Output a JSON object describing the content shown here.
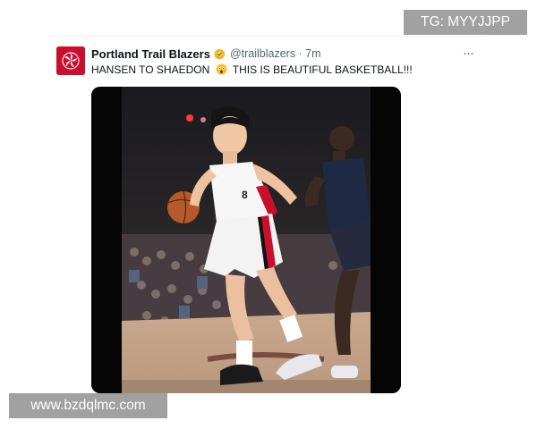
{
  "tweet": {
    "author_name": "Portland Trail Blazers",
    "handle_time": "@trailblazers · 7m",
    "text_before_emoji": "HANSEN TO SHAEDON",
    "emoji_icon": "astonished-face-emoji",
    "text_after_emoji": "THIS IS BEAUTIFUL BASKETBALL!!!",
    "more_icon": "ellipsis-horizontal-icon",
    "more_glyph": "···",
    "verified_icon": "gold-verified-badge-icon",
    "avatar_icon": "trail-blazers-pinwheel-logo-icon"
  },
  "media": {
    "kind": "video-still",
    "jersey_number": "8"
  },
  "watermarks": {
    "top": "TG: MYYJJPP",
    "bottom": "www.bzdqlmc.com"
  },
  "colors": {
    "brand_red": "#c8102e",
    "verified_gold": "#e2b719",
    "text_primary": "#0f1419",
    "text_secondary": "#536471"
  }
}
